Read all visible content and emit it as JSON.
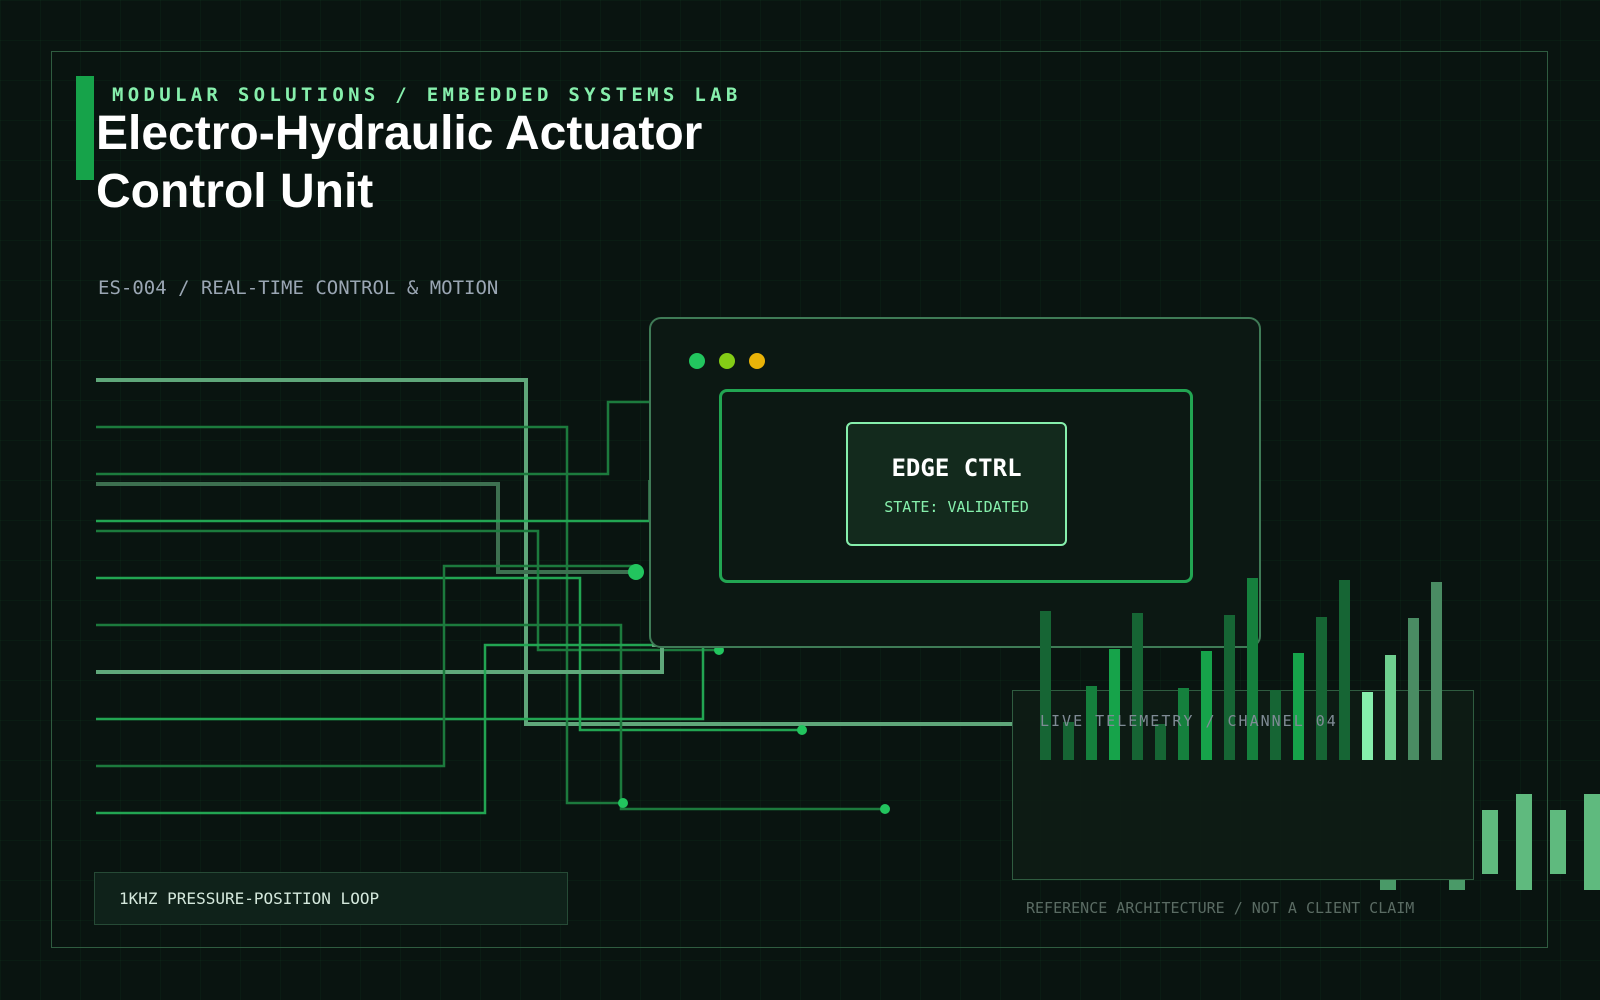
{
  "header": {
    "eyebrow": "MODULAR SOLUTIONS / EMBEDDED SYSTEMS LAB",
    "title_line1": "Electro-Hydraulic Actuator",
    "title_line2": "Control Unit",
    "subtitle": "ES-004 / REAL-TIME CONTROL & MOTION"
  },
  "controller_window": {
    "card_title": "EDGE CTRL",
    "state": "STATE: VALIDATED",
    "status_dots": [
      "green",
      "lime",
      "amber"
    ]
  },
  "telemetry": {
    "label": "LIVE TELEMETRY / CHANNEL 04"
  },
  "loop_badge": "1KHZ PRESSURE-POSITION LOOP",
  "footer_note": "REFERENCE ARCHITECTURE / NOT A CLIENT CLAIM",
  "colors": {
    "background": "#091410",
    "accent": "#22c55e",
    "accent_dark": "#16a34a",
    "accent_light": "#86efac",
    "dot_green": "#22c55e",
    "dot_lime": "#84cc16",
    "dot_amber": "#eab308"
  }
}
